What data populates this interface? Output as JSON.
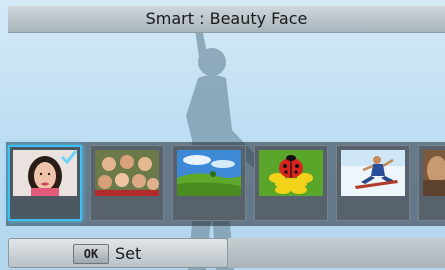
{
  "header": {
    "title": "Smart : Beauty Face"
  },
  "scene": {
    "background_color": "#bcdcf2",
    "silhouette": "person-silhouette"
  },
  "modes": [
    {
      "name": "beauty-face",
      "selected": true
    },
    {
      "name": "group-shot",
      "selected": false
    },
    {
      "name": "landscape",
      "selected": false
    },
    {
      "name": "macro-ladybug",
      "selected": false
    },
    {
      "name": "action-freeze",
      "selected": false
    },
    {
      "name": "more-scenes",
      "selected": false
    }
  ],
  "footer": {
    "ok_key": "OK",
    "set_label": "Set"
  },
  "colors": {
    "selection_accent": "#3ec0f2"
  }
}
